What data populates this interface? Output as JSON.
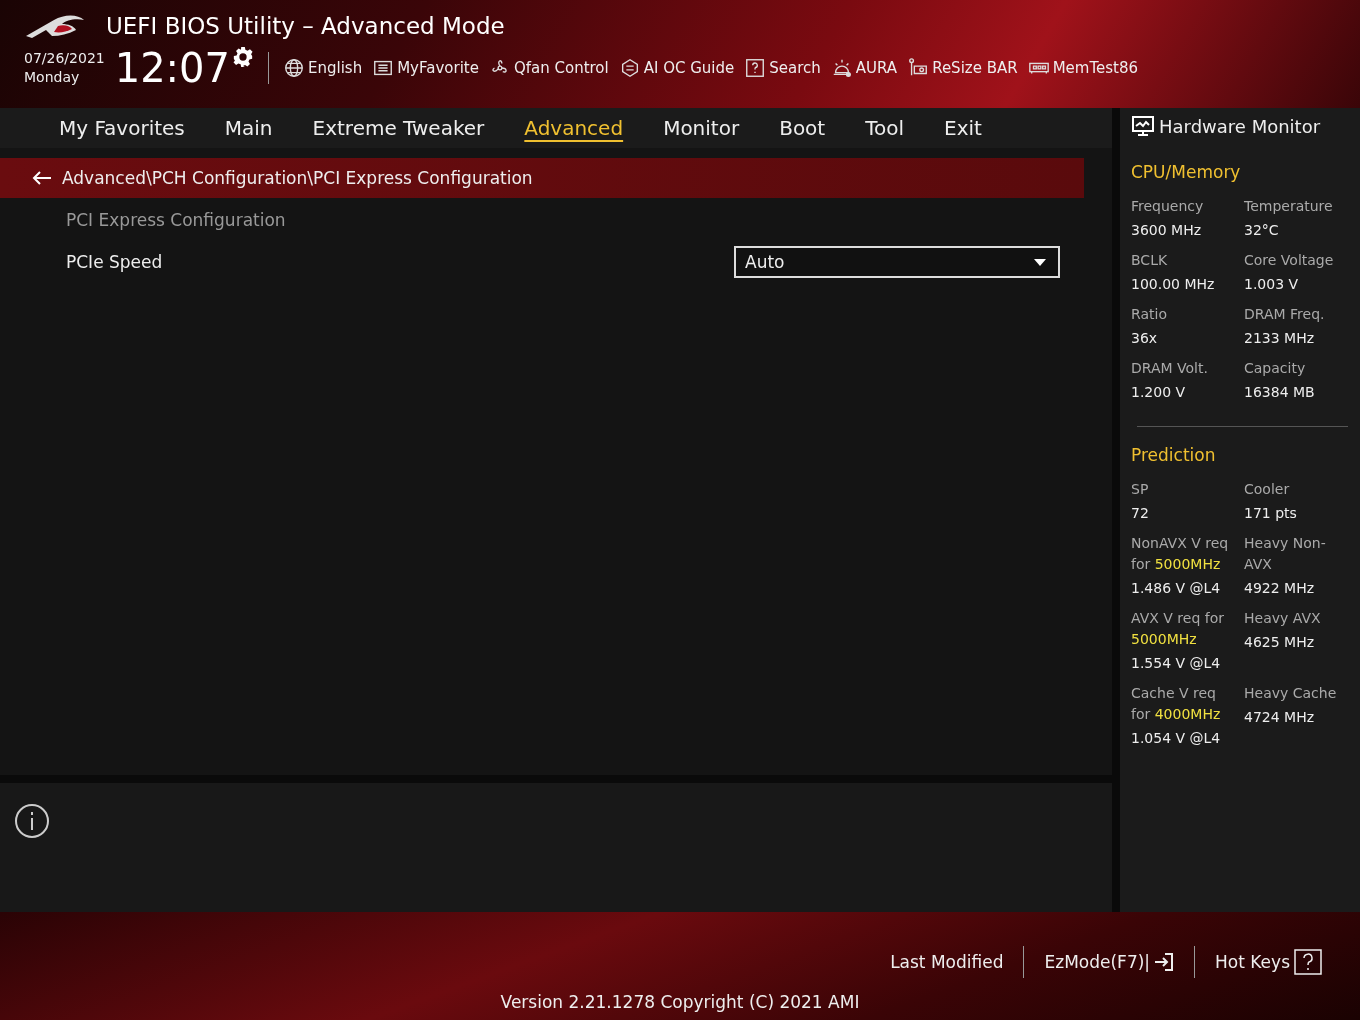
{
  "header": {
    "title": "UEFI BIOS Utility – Advanced Mode",
    "date": "07/26/2021",
    "day": "Monday",
    "time": "12:07",
    "toolbar": [
      {
        "label": "English"
      },
      {
        "label": "MyFavorite"
      },
      {
        "label": "Qfan Control"
      },
      {
        "label": "AI OC Guide"
      },
      {
        "label": "Search"
      },
      {
        "label": "AURA"
      },
      {
        "label": "ReSize BAR"
      },
      {
        "label": "MemTest86"
      }
    ]
  },
  "tabs": [
    {
      "label": "My Favorites",
      "selected": false
    },
    {
      "label": "Main",
      "selected": false
    },
    {
      "label": "Extreme Tweaker",
      "selected": false
    },
    {
      "label": "Advanced",
      "selected": true
    },
    {
      "label": "Monitor",
      "selected": false
    },
    {
      "label": "Boot",
      "selected": false
    },
    {
      "label": "Tool",
      "selected": false
    },
    {
      "label": "Exit",
      "selected": false
    }
  ],
  "breadcrumb": "Advanced\\PCH Configuration\\PCI Express Configuration",
  "settings": [
    {
      "kind": "heading",
      "label": "PCI Express Configuration"
    },
    {
      "kind": "dropdown",
      "label": "PCIe Speed",
      "value": "Auto"
    }
  ],
  "hardware_monitor": {
    "title": "Hardware Monitor",
    "sections": [
      {
        "title": "CPU/Memory",
        "items": [
          {
            "label": "Frequency",
            "value": "3600 MHz"
          },
          {
            "label": "Temperature",
            "value": "32°C"
          },
          {
            "label": "BCLK",
            "value": "100.00 MHz"
          },
          {
            "label": "Core Voltage",
            "value": "1.003 V"
          },
          {
            "label": "Ratio",
            "value": "36x"
          },
          {
            "label": "DRAM Freq.",
            "value": "2133 MHz"
          },
          {
            "label": "DRAM Volt.",
            "value": "1.200 V"
          },
          {
            "label": "Capacity",
            "value": "16384 MB"
          }
        ]
      },
      {
        "title": "Prediction",
        "items": [
          {
            "label": "SP",
            "value": "72"
          },
          {
            "label": "Cooler",
            "value": "171 pts"
          },
          {
            "label": "NonAVX V req for",
            "highlight": "5000MHz",
            "value": "1.486 V @L4"
          },
          {
            "label": "Heavy Non-AVX",
            "value": "4922 MHz"
          },
          {
            "label": "AVX V req for",
            "highlight": "5000MHz",
            "value": "1.554 V @L4"
          },
          {
            "label": "Heavy AVX",
            "value": "4625 MHz"
          },
          {
            "label": "Cache V req for",
            "highlight": "4000MHz",
            "value": "1.054 V @L4"
          },
          {
            "label": "Heavy Cache",
            "value": "4724 MHz"
          }
        ]
      }
    ]
  },
  "footer": {
    "links": [
      {
        "label": "Last Modified"
      },
      {
        "label": "EzMode(F7)|"
      },
      {
        "label": "Hot Keys"
      }
    ],
    "version": "Version 2.21.1278 Copyright (C) 2021 AMI"
  }
}
